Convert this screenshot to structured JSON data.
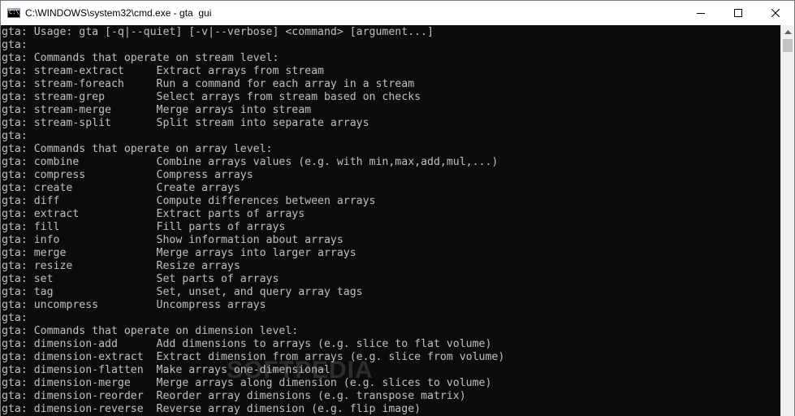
{
  "window": {
    "title": "C:\\WINDOWS\\system32\\cmd.exe - gta  gui",
    "icon_text": "C:\\_",
    "icons": {
      "app": "cmd-icon",
      "minimize": "minimize-icon",
      "maximize": "maximize-icon",
      "close": "close-icon",
      "scroll_up": "scroll-up-arrow-icon"
    }
  },
  "console": {
    "lines": [
      "gta: Usage: gta [-q|--quiet] [-v|--verbose] <command> [argument...]",
      "gta:",
      "gta: Commands that operate on stream level:",
      "gta: stream-extract     Extract arrays from stream",
      "gta: stream-foreach     Run a command for each array in a stream",
      "gta: stream-grep        Select arrays from stream based on checks",
      "gta: stream-merge       Merge arrays into stream",
      "gta: stream-split       Split stream into separate arrays",
      "gta:",
      "gta: Commands that operate on array level:",
      "gta: combine            Combine arrays values (e.g. with min,max,add,mul,...)",
      "gta: compress           Compress arrays",
      "gta: create             Create arrays",
      "gta: diff               Compute differences between arrays",
      "gta: extract            Extract parts of arrays",
      "gta: fill               Fill parts of arrays",
      "gta: info               Show information about arrays",
      "gta: merge              Merge arrays into larger arrays",
      "gta: resize             Resize arrays",
      "gta: set                Set parts of arrays",
      "gta: tag                Set, unset, and query array tags",
      "gta: uncompress         Uncompress arrays",
      "gta:",
      "gta: Commands that operate on dimension level:",
      "gta: dimension-add      Add dimensions to arrays (e.g. slice to flat volume)",
      "gta: dimension-extract  Extract dimension from arrays (e.g. slice from volume)",
      "gta: dimension-flatten  Make arrays one-dimensional",
      "gta: dimension-merge    Merge arrays along dimension (e.g. slices to volume)",
      "gta: dimension-reorder  Reorder array dimensions (e.g. transpose matrix)",
      "gta: dimension-reverse  Reverse array dimension (e.g. flip image)"
    ]
  },
  "watermark": "SOFTPEDIA",
  "colors": {
    "console_bg": "#0c0c0c",
    "console_fg": "#c0c0c0",
    "titlebar_bg": "#ffffff"
  }
}
